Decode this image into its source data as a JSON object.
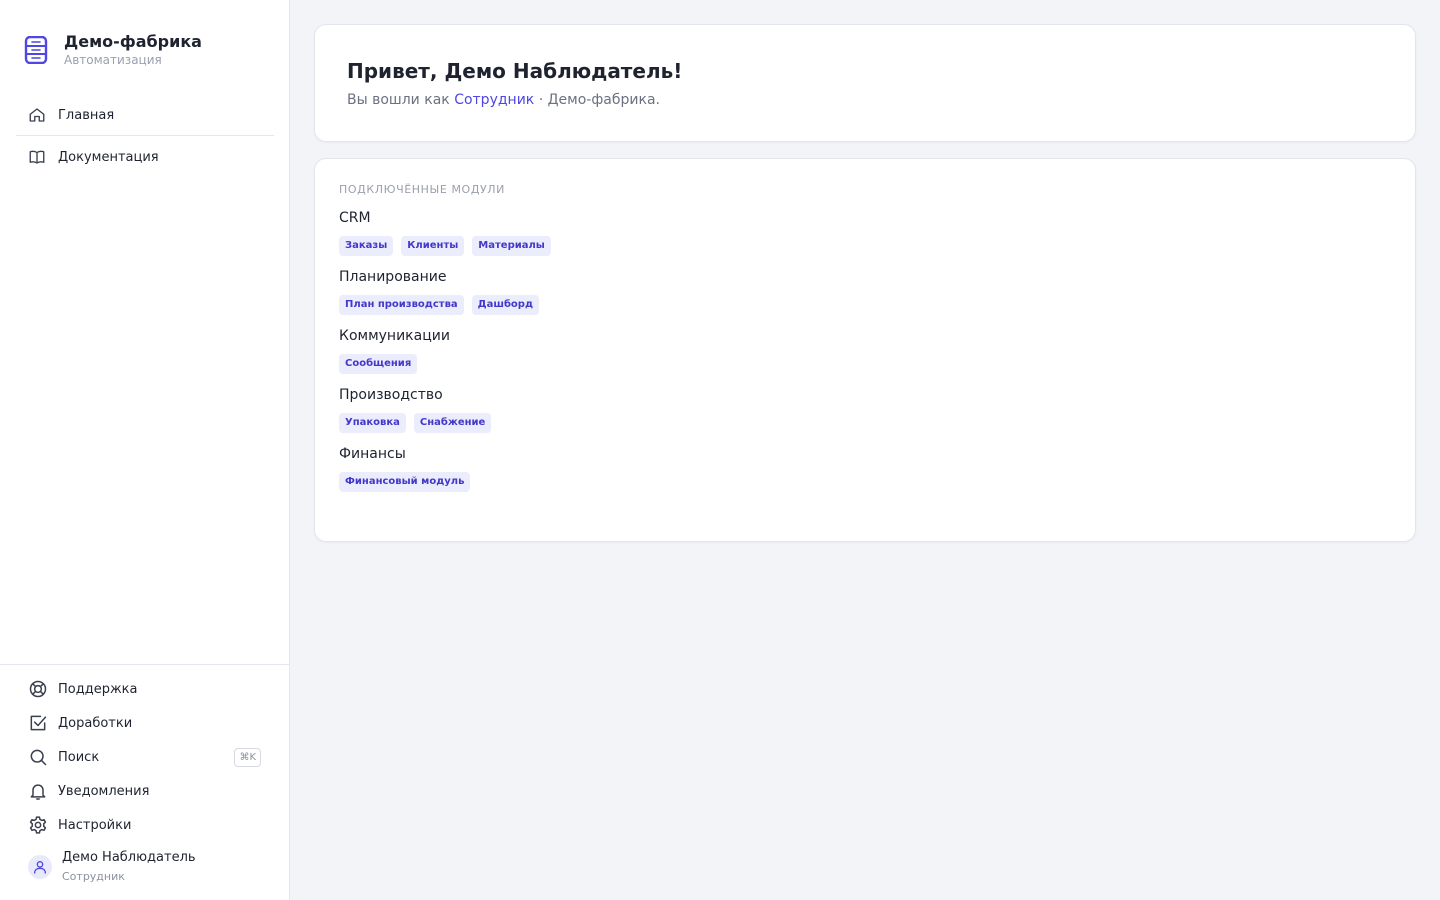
{
  "brand": {
    "title": "Демо-фабрика",
    "subtitle": "Автоматизация"
  },
  "nav": {
    "items": [
      {
        "label": "Главная",
        "icon": "home-icon"
      },
      {
        "label": "Документация",
        "icon": "book-icon"
      }
    ]
  },
  "bottom_nav": {
    "items": [
      {
        "label": "Поддержка",
        "icon": "lifebuoy-icon"
      },
      {
        "label": "Доработки",
        "icon": "checkbox-icon"
      },
      {
        "label": "Поиск",
        "icon": "search-icon",
        "shortcut": "⌘K"
      },
      {
        "label": "Уведомления",
        "icon": "bell-icon"
      },
      {
        "label": "Настройки",
        "icon": "gear-icon"
      }
    ]
  },
  "user": {
    "name": "Демо Наблюдатель",
    "role": "Сотрудник"
  },
  "greeting": {
    "title": "Привет, Демо Наблюдатель!",
    "prefix": "Вы вошли как ",
    "role": "Сотрудник",
    "suffix": " · Демо-фабрика."
  },
  "modules": {
    "label": "ПОДКЛЮЧЁННЫЕ МОДУЛИ",
    "groups": [
      {
        "title": "CRM",
        "items": [
          "Заказы",
          "Клиенты",
          "Материалы"
        ]
      },
      {
        "title": "Планирование",
        "items": [
          "План производства",
          "Дашборд"
        ]
      },
      {
        "title": "Коммуникации",
        "items": [
          "Сообщения"
        ]
      },
      {
        "title": "Производство",
        "items": [
          "Упаковка",
          "Снабжение"
        ]
      },
      {
        "title": "Финансы",
        "items": [
          "Финансовый модуль"
        ]
      }
    ]
  },
  "colors": {
    "accent": "#4f46e5",
    "chip_bg": "#ecedfc",
    "background": "#f3f4f8"
  }
}
